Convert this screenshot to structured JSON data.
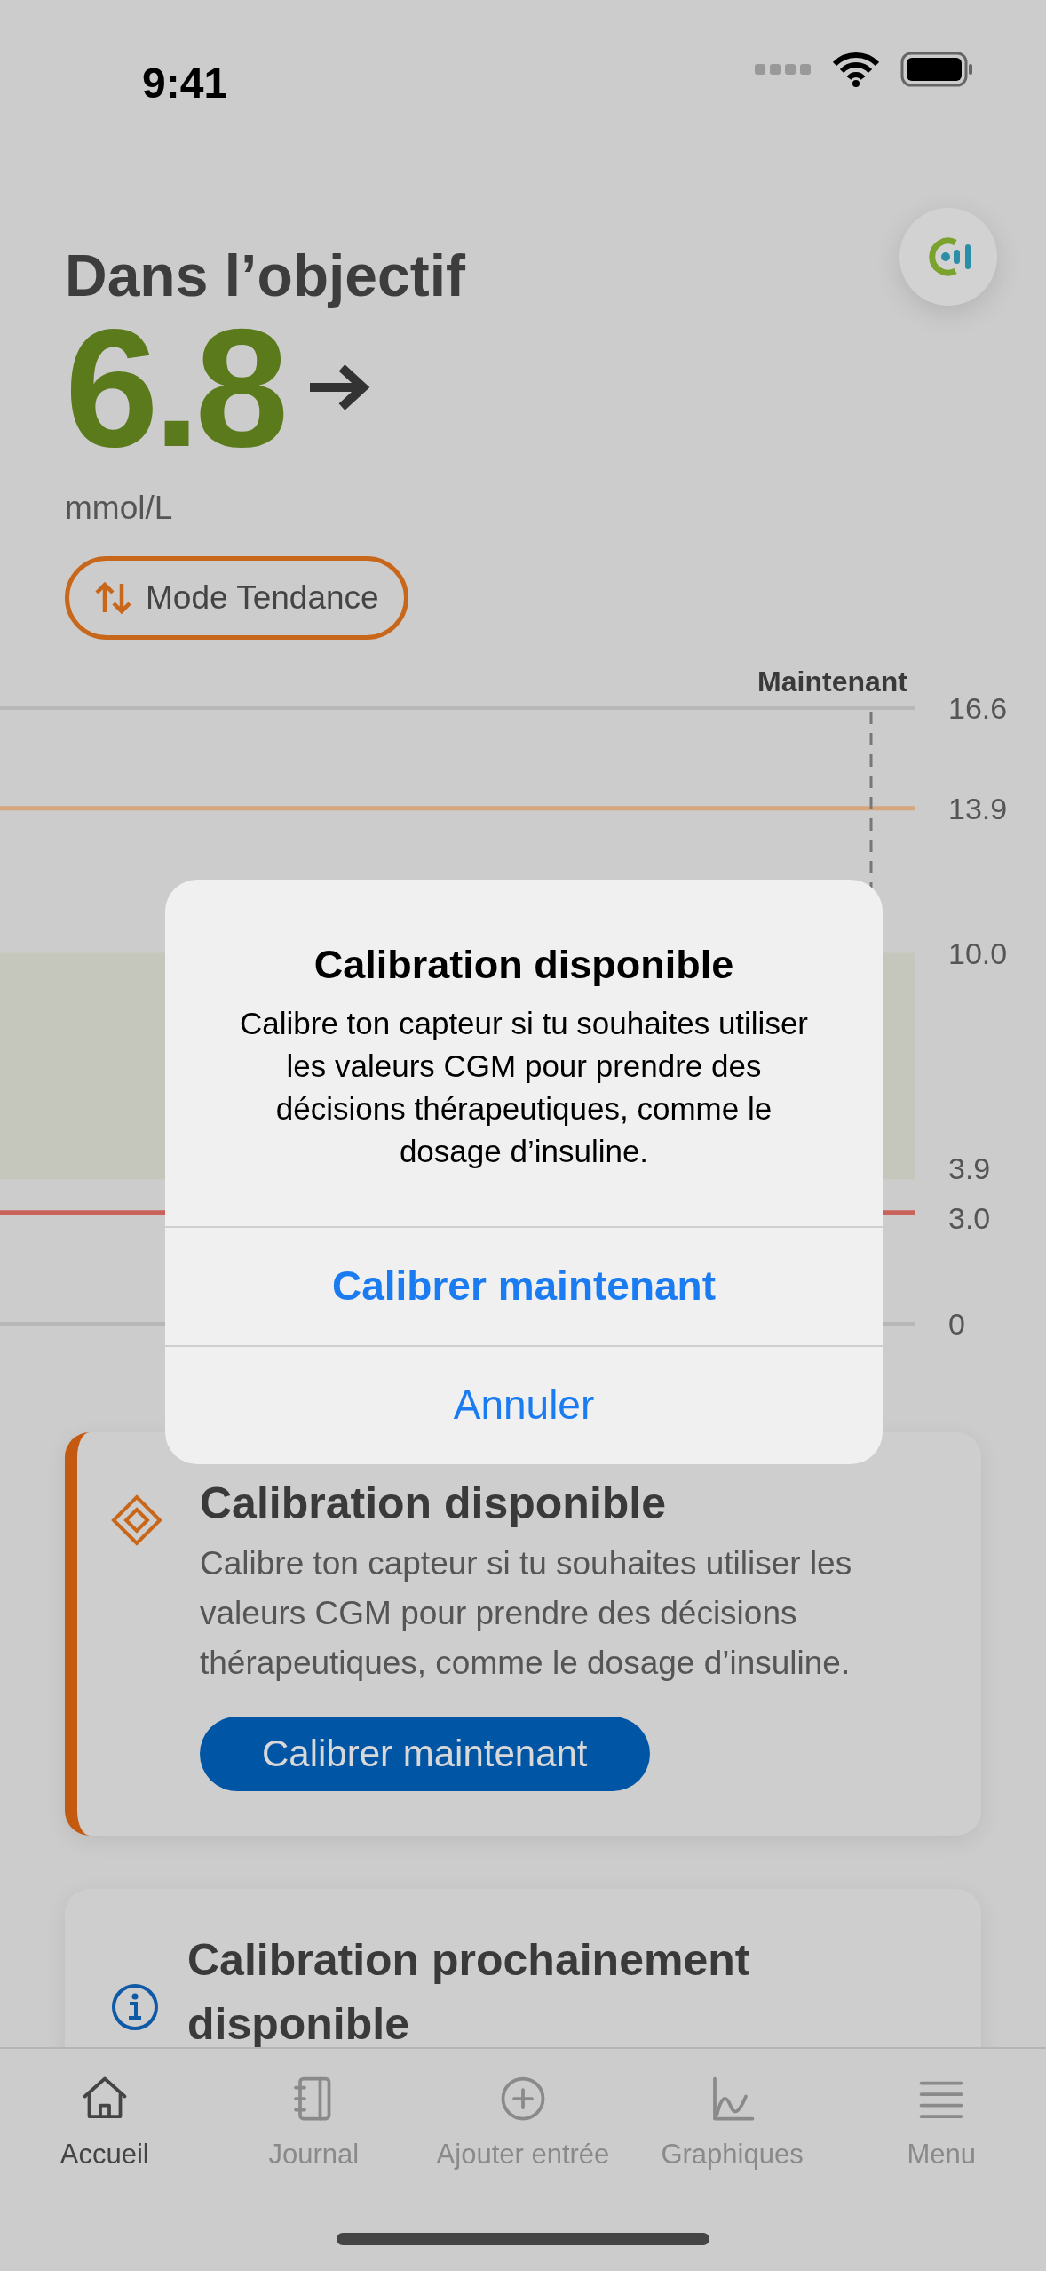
{
  "status_bar": {
    "time": "9:41"
  },
  "glucose": {
    "status": "Dans l’objectif",
    "value": "6.8",
    "unit": "mmol/L",
    "mode_badge": "Mode Tendance"
  },
  "chart": {
    "now_label": "Maintenant",
    "y_labels": [
      "16.6",
      "13.9",
      "10.0",
      "3.9",
      "3.0",
      "0"
    ]
  },
  "cards": [
    {
      "kind": "warning",
      "title": "Calibration disponible",
      "body": "Calibre ton capteur si tu souhaites utiliser les valeurs CGM pour prendre des décisions thérapeutiques, comme le dosage d’insuline.",
      "button": "Calibrer maintenant"
    },
    {
      "kind": "info",
      "title": "Calibration prochainement disponible"
    }
  ],
  "dialog": {
    "title": "Calibration disponible",
    "message": "Calibre ton capteur si tu souhaites utiliser les valeurs CGM pour prendre des décisions thérapeutiques, comme le dosage d’insuline.",
    "buttons": [
      {
        "label": "Calibrer maintenant",
        "kind": "primary"
      },
      {
        "label": "Annuler",
        "kind": "cancel"
      }
    ]
  },
  "tab_bar": [
    {
      "label": "Accueil",
      "kind": "home",
      "selected": true
    },
    {
      "label": "Journal",
      "kind": "journal",
      "selected": false
    },
    {
      "label": "Ajouter entrée",
      "kind": "add",
      "selected": false
    },
    {
      "label": "Graphiques",
      "kind": "graph",
      "selected": false
    },
    {
      "label": "Menu",
      "kind": "menu",
      "selected": false
    }
  ]
}
